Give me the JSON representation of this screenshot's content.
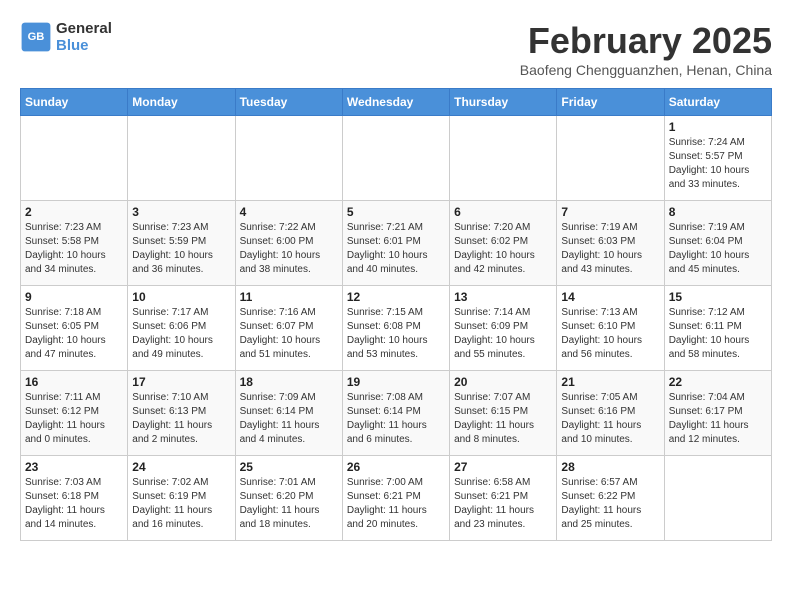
{
  "header": {
    "logo_general": "General",
    "logo_blue": "Blue",
    "month_title": "February 2025",
    "location": "Baofeng Chengguanzhen, Henan, China"
  },
  "days_of_week": [
    "Sunday",
    "Monday",
    "Tuesday",
    "Wednesday",
    "Thursday",
    "Friday",
    "Saturday"
  ],
  "weeks": [
    [
      {
        "day": "",
        "info": ""
      },
      {
        "day": "",
        "info": ""
      },
      {
        "day": "",
        "info": ""
      },
      {
        "day": "",
        "info": ""
      },
      {
        "day": "",
        "info": ""
      },
      {
        "day": "",
        "info": ""
      },
      {
        "day": "1",
        "info": "Sunrise: 7:24 AM\nSunset: 5:57 PM\nDaylight: 10 hours and 33 minutes."
      }
    ],
    [
      {
        "day": "2",
        "info": "Sunrise: 7:23 AM\nSunset: 5:58 PM\nDaylight: 10 hours and 34 minutes."
      },
      {
        "day": "3",
        "info": "Sunrise: 7:23 AM\nSunset: 5:59 PM\nDaylight: 10 hours and 36 minutes."
      },
      {
        "day": "4",
        "info": "Sunrise: 7:22 AM\nSunset: 6:00 PM\nDaylight: 10 hours and 38 minutes."
      },
      {
        "day": "5",
        "info": "Sunrise: 7:21 AM\nSunset: 6:01 PM\nDaylight: 10 hours and 40 minutes."
      },
      {
        "day": "6",
        "info": "Sunrise: 7:20 AM\nSunset: 6:02 PM\nDaylight: 10 hours and 42 minutes."
      },
      {
        "day": "7",
        "info": "Sunrise: 7:19 AM\nSunset: 6:03 PM\nDaylight: 10 hours and 43 minutes."
      },
      {
        "day": "8",
        "info": "Sunrise: 7:19 AM\nSunset: 6:04 PM\nDaylight: 10 hours and 45 minutes."
      }
    ],
    [
      {
        "day": "9",
        "info": "Sunrise: 7:18 AM\nSunset: 6:05 PM\nDaylight: 10 hours and 47 minutes."
      },
      {
        "day": "10",
        "info": "Sunrise: 7:17 AM\nSunset: 6:06 PM\nDaylight: 10 hours and 49 minutes."
      },
      {
        "day": "11",
        "info": "Sunrise: 7:16 AM\nSunset: 6:07 PM\nDaylight: 10 hours and 51 minutes."
      },
      {
        "day": "12",
        "info": "Sunrise: 7:15 AM\nSunset: 6:08 PM\nDaylight: 10 hours and 53 minutes."
      },
      {
        "day": "13",
        "info": "Sunrise: 7:14 AM\nSunset: 6:09 PM\nDaylight: 10 hours and 55 minutes."
      },
      {
        "day": "14",
        "info": "Sunrise: 7:13 AM\nSunset: 6:10 PM\nDaylight: 10 hours and 56 minutes."
      },
      {
        "day": "15",
        "info": "Sunrise: 7:12 AM\nSunset: 6:11 PM\nDaylight: 10 hours and 58 minutes."
      }
    ],
    [
      {
        "day": "16",
        "info": "Sunrise: 7:11 AM\nSunset: 6:12 PM\nDaylight: 11 hours and 0 minutes."
      },
      {
        "day": "17",
        "info": "Sunrise: 7:10 AM\nSunset: 6:13 PM\nDaylight: 11 hours and 2 minutes."
      },
      {
        "day": "18",
        "info": "Sunrise: 7:09 AM\nSunset: 6:14 PM\nDaylight: 11 hours and 4 minutes."
      },
      {
        "day": "19",
        "info": "Sunrise: 7:08 AM\nSunset: 6:14 PM\nDaylight: 11 hours and 6 minutes."
      },
      {
        "day": "20",
        "info": "Sunrise: 7:07 AM\nSunset: 6:15 PM\nDaylight: 11 hours and 8 minutes."
      },
      {
        "day": "21",
        "info": "Sunrise: 7:05 AM\nSunset: 6:16 PM\nDaylight: 11 hours and 10 minutes."
      },
      {
        "day": "22",
        "info": "Sunrise: 7:04 AM\nSunset: 6:17 PM\nDaylight: 11 hours and 12 minutes."
      }
    ],
    [
      {
        "day": "23",
        "info": "Sunrise: 7:03 AM\nSunset: 6:18 PM\nDaylight: 11 hours and 14 minutes."
      },
      {
        "day": "24",
        "info": "Sunrise: 7:02 AM\nSunset: 6:19 PM\nDaylight: 11 hours and 16 minutes."
      },
      {
        "day": "25",
        "info": "Sunrise: 7:01 AM\nSunset: 6:20 PM\nDaylight: 11 hours and 18 minutes."
      },
      {
        "day": "26",
        "info": "Sunrise: 7:00 AM\nSunset: 6:21 PM\nDaylight: 11 hours and 20 minutes."
      },
      {
        "day": "27",
        "info": "Sunrise: 6:58 AM\nSunset: 6:21 PM\nDaylight: 11 hours and 23 minutes."
      },
      {
        "day": "28",
        "info": "Sunrise: 6:57 AM\nSunset: 6:22 PM\nDaylight: 11 hours and 25 minutes."
      },
      {
        "day": "",
        "info": ""
      }
    ]
  ]
}
